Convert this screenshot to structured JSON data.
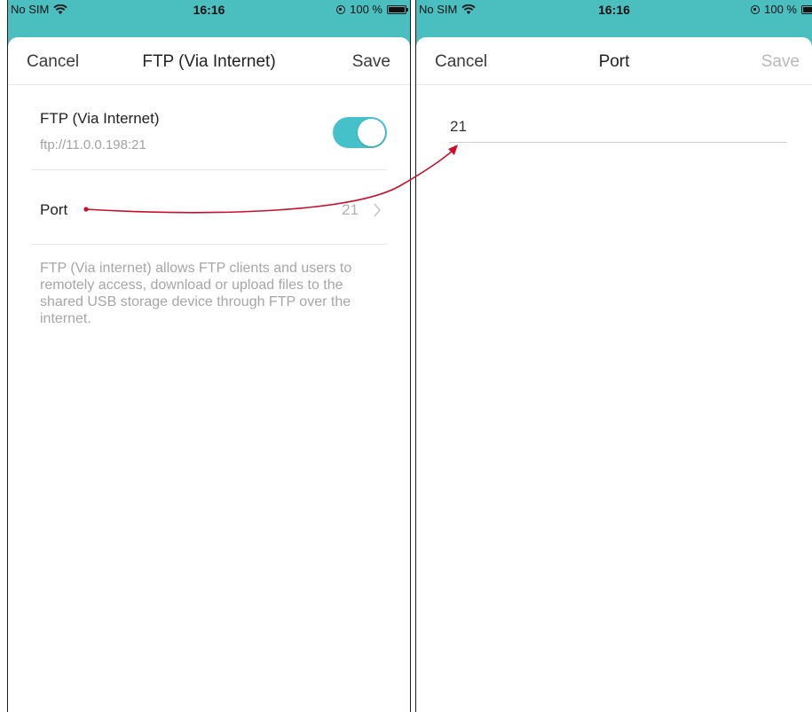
{
  "left_screen": {
    "status_bar": {
      "carrier": "No SIM",
      "time": "16:16",
      "battery": "100 %"
    },
    "navbar": {
      "cancel_label": "Cancel",
      "title": "FTP (Via Internet)",
      "save_label": "Save"
    },
    "ftp_row": {
      "label": "FTP (Via Internet)",
      "address": "ftp://11.0.0.198:21",
      "enabled": true
    },
    "port_row": {
      "label": "Port",
      "value": "21"
    },
    "description": "FTP (Via internet) allows FTP clients and users to remotely access, download or upload files to the shared USB storage device through FTP over the internet."
  },
  "right_screen": {
    "status_bar": {
      "carrier": "No SIM",
      "time": "16:16",
      "battery": "100 %"
    },
    "navbar": {
      "cancel_label": "Cancel",
      "title": "Port",
      "save_label": "Save",
      "save_enabled": false
    },
    "port_input": {
      "value": "21"
    }
  },
  "colors": {
    "accent_teal": "#45c2c9",
    "header_bg": "#4bbfbf",
    "annotation_arrow": "#c8102e"
  }
}
